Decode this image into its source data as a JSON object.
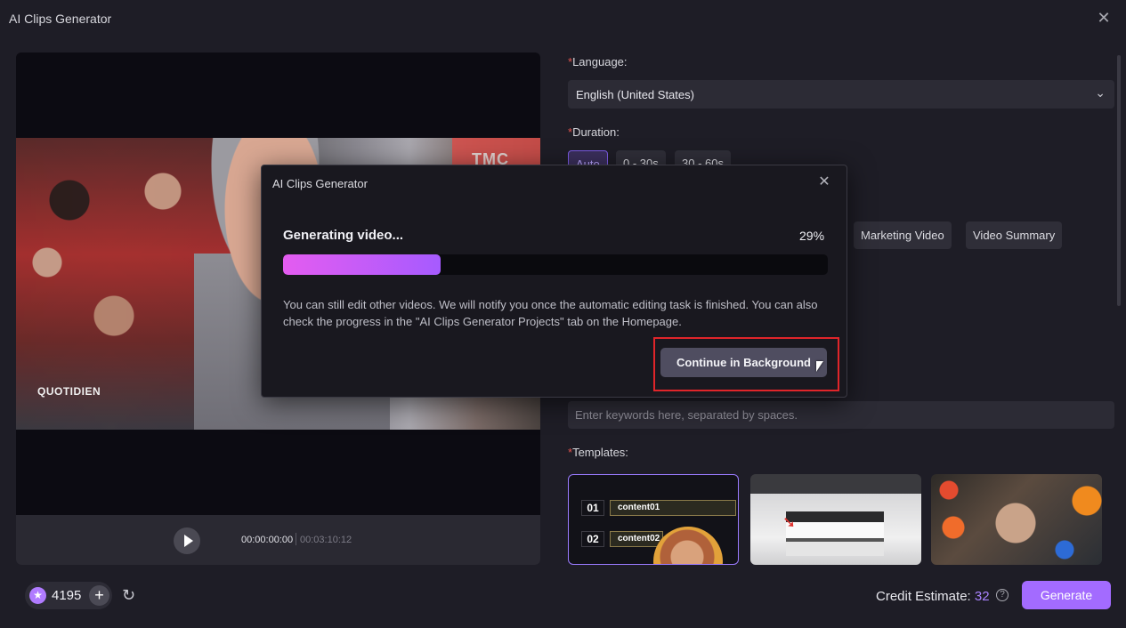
{
  "window": {
    "title": "AI Clips Generator",
    "close_icon": "close-icon"
  },
  "video": {
    "overlay_logo": "TMC",
    "watermark": "QUOTIDIEN",
    "time_current": "00:00:00:00",
    "time_total": "00:03:10:12"
  },
  "settings": {
    "language_label": "Language:",
    "language_value": "English (United States)",
    "duration_label": "Duration:",
    "duration_options": [
      "Auto",
      "0 - 30s",
      "30 - 60s"
    ],
    "style_options": [
      "Marketing Video",
      "Video Summary"
    ],
    "keywords_placeholder": "Enter keywords here, separated by spaces.",
    "templates_label": "Templates:",
    "template1_rows": [
      "01",
      "content01",
      "02",
      "content02"
    ]
  },
  "footer": {
    "credits": "4195",
    "credit_estimate_label": "Credit Estimate:",
    "credit_estimate_value": "32",
    "generate_label": "Generate"
  },
  "modal": {
    "title": "AI Clips Generator",
    "status": "Generating video...",
    "percent_text": "29%",
    "progress": 0.29,
    "message": "You can still edit other videos. We will notify you once the automatic editing task is finished. You can also check the progress in the \"AI Clips Generator Projects\" tab on the Homepage.",
    "continue_label": "Continue in Background"
  },
  "colors": {
    "accent": "#a36bff",
    "progress_start": "#e45cf0",
    "progress_end": "#a65bff",
    "highlight": "#e0252a"
  }
}
